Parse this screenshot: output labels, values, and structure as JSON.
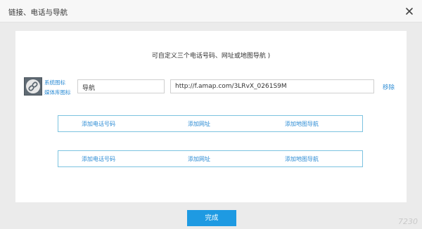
{
  "dialog": {
    "title": "链接、电话与导航",
    "hint": "可自定义三个电话号码、网址或地图导航 )",
    "done_label": "完成"
  },
  "link_item": {
    "icon": "link-icon",
    "system_icon_label": "系统图标",
    "media_icon_label": "媒体库图标",
    "name_value": "导航",
    "url_value": "http://f.amap.com/3LRvX_0261S9M",
    "remove_label": "移除"
  },
  "action_rows": [
    {
      "phone": "添加电话号码",
      "url": "添加网址",
      "map": "添加地图导航"
    },
    {
      "phone": "添加电话号码",
      "url": "添加网址",
      "map": "添加地图导航"
    }
  ],
  "watermark": "7230"
}
